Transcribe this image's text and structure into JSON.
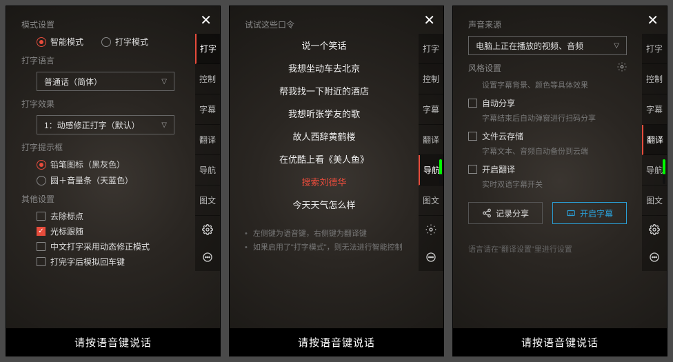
{
  "common": {
    "footer": "请按语音键说话",
    "sidebar": [
      "打字",
      "控制",
      "字幕",
      "翻译",
      "导航",
      "图文"
    ]
  },
  "panel1": {
    "s1_title": "模式设置",
    "mode_smart": "智能模式",
    "mode_type": "打字模式",
    "s2_title": "打字语言",
    "lang_value": "普通话（简体）",
    "s3_title": "打字效果",
    "effect_value": "1：动感修正打字（默认）",
    "s4_title": "打字提示框",
    "tip_pencil": "铅笔图标（黑灰色）",
    "tip_circle": "圆＋音量条（天蓝色）",
    "s5_title": "其他设置",
    "opt1": "去除标点",
    "opt2": "光标跟随",
    "opt3": "中文打字采用动态修正模式",
    "opt4": "打完字后模拟回车键",
    "active_tab": 0
  },
  "panel2": {
    "title": "试试这些口令",
    "cmds": [
      "说一个笑话",
      "我想坐动车去北京",
      "帮我找一下附近的酒店",
      "我想听张学友的歌",
      "故人西辞黄鹤楼",
      "在优酷上看《美人鱼》",
      "搜索刘德华",
      "今天天气怎么样"
    ],
    "tip1": "左侧键为语音键，右侧键为翻译键",
    "tip2": "如果启用了\"打字模式\"，则无法进行智能控制",
    "active_tab": 4,
    "hot_index": 6
  },
  "panel3": {
    "s1_title": "声音来源",
    "source_value": "电脑上正在播放的视频、音频",
    "s2_title": "风格设置",
    "s2_hint": "设置字幕背景、颜色等具体效果",
    "c1": "自动分享",
    "c1_hint": "字幕结束后自动弹窗进行扫码分享",
    "c2": "文件云存储",
    "c2_hint": "字幕文本、音频自动备份到云端",
    "c3": "开启翻译",
    "c3_hint": "实时双语字幕开关",
    "btn_share": "记录分享",
    "btn_open": "开启字幕",
    "lang_note": "语言请在\"翻译设置\"里进行设置",
    "active_tab": 3
  }
}
